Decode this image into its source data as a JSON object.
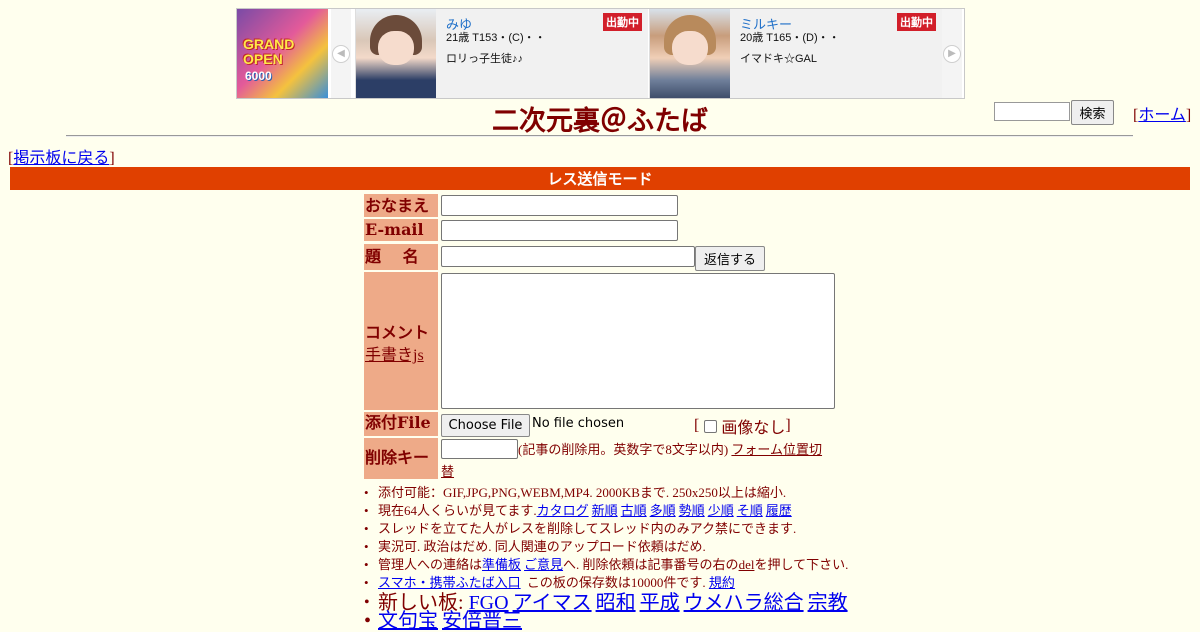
{
  "banner": {
    "promo_text1": "GRAND OPEN",
    "promo_text2": "6000",
    "cards": [
      {
        "name": "みゆ",
        "badge": "出勤中",
        "spec": "21歳 T153・(C)・・",
        "desc": "ロリっ子生徒♪♪"
      },
      {
        "name": "ミルキー",
        "badge": "出勤中",
        "spec": "20歳 T165・(D)・・",
        "desc": "イマドキ☆GAL"
      }
    ]
  },
  "header": {
    "site_title": "二次元裏＠ふたば",
    "search_label": "検索",
    "home_link": "ホーム"
  },
  "nav": {
    "back_link": "掲示板に戻る"
  },
  "mode_bar": "レス送信モード",
  "form": {
    "name_label": "おなまえ",
    "email_label": "E-mail",
    "subject_label": "題　 名",
    "reply_button": "返信する",
    "comment_label": "コメント",
    "handwriting_link": "手書きjs",
    "file_label": "添付File",
    "file_button": "Choose File",
    "file_status": "No file chosen",
    "no_image_label": "画像なし",
    "delkey_label": "削除キー",
    "delkey_note": "(記事の削除用。英数字で8文字以内)",
    "form_pos_link_a": "フォーム位置切",
    "form_pos_link_b": "替"
  },
  "notes": {
    "line1": "添付可能：GIF,JPG,PNG,WEBM,MP4. 2000KBまで. 250x250以上は縮小.",
    "line2_prefix": "現在64人くらいが見てます.",
    "line2_links": [
      "カタログ",
      "新順",
      "古順",
      "多順",
      "勢順",
      "少順",
      "そ順",
      "履歴"
    ],
    "line3": "スレッドを立てた人がレスを削除してスレッド内のみアク禁にできます.",
    "line4": "実況可. 政治はだめ. 同人関連のアップロード依頼はだめ.",
    "line5_a": "管理人への連絡は",
    "line5_link1": "準備板",
    "line5_link2": "ご意見",
    "line5_b": "へ. 削除依頼は記事番号の右の",
    "line5_del": "del",
    "line5_c": "を押して下さい.",
    "line6_link": "スマホ・携帯ふたば入口",
    "line6_text": "この板の保存数は10000件です.",
    "line6_link2": "規約",
    "newboards_label": "新しい板:",
    "newboards_links": [
      "FGO",
      "アイマス",
      "昭和",
      "平成",
      "ウメハラ総合",
      "宗教"
    ],
    "newboards_links2": [
      "文句宝",
      "安倍晋三"
    ]
  }
}
